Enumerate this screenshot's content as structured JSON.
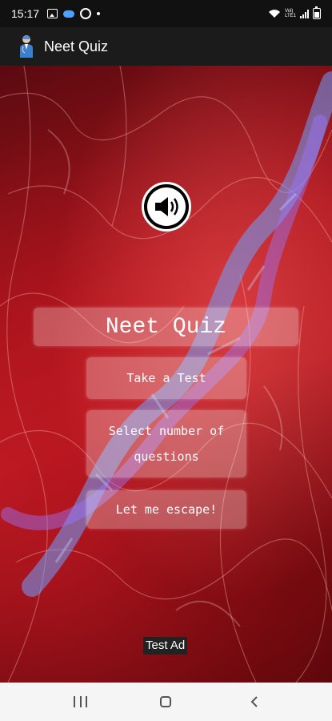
{
  "status_bar": {
    "time": "15:17",
    "network_label_top": "Vol)",
    "network_label_bottom": "LTE1"
  },
  "app_bar": {
    "title": "Neet Quiz"
  },
  "main": {
    "heading": "Neet Quiz",
    "buttons": {
      "take_test": "Take a Test",
      "select_questions": "Select number of questions",
      "escape": "Let me escape!"
    }
  },
  "ad": {
    "label": "Test Ad"
  },
  "icons": {
    "sound": "speaker-icon",
    "logo": "doctor-avatar-icon",
    "nav": [
      "recents-icon",
      "home-icon",
      "back-icon"
    ]
  },
  "colors": {
    "app_bar": "#1b1b1b",
    "background_red": "#c82028",
    "dna_blue": "#6aa8ff"
  }
}
